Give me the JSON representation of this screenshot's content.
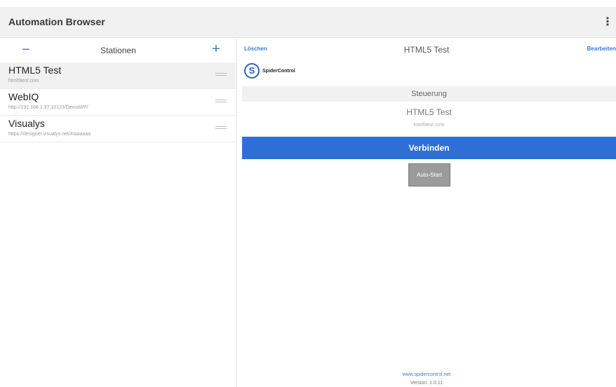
{
  "app": {
    "title": "Automation Browser",
    "menu_icon": "overflow-menu-icon"
  },
  "stations_panel": {
    "title": "Stationen",
    "minus_label": "−",
    "plus_label": "+",
    "items": [
      {
        "name": "HTML5 Test",
        "url": "html5test.com",
        "selected": true
      },
      {
        "name": "WebIQ",
        "url": "http://192.168.1.37:10123/DemoWP/",
        "selected": false
      },
      {
        "name": "Visualys",
        "url": "https://designer.visualys.net/#/aaaaaa",
        "selected": false
      }
    ]
  },
  "detail": {
    "delete_label": "Löschen",
    "title": "HTML5 Test",
    "edit_label": "Bearbeiten",
    "logo_letter": "S",
    "logo_text": "SpiderControl",
    "section_label": "Steuerung",
    "station_name": "HTML5 Test",
    "station_url": "html5test.com",
    "connect_label": "Verbinden",
    "autostart_label": "Auto-Start",
    "footer_link": "www.spidercontrol.net",
    "version": "Version: 1.0.11"
  },
  "colors": {
    "accent": "#2e6fd6",
    "link": "#3b7bd8",
    "bar_bg": "#f1f1f1"
  }
}
